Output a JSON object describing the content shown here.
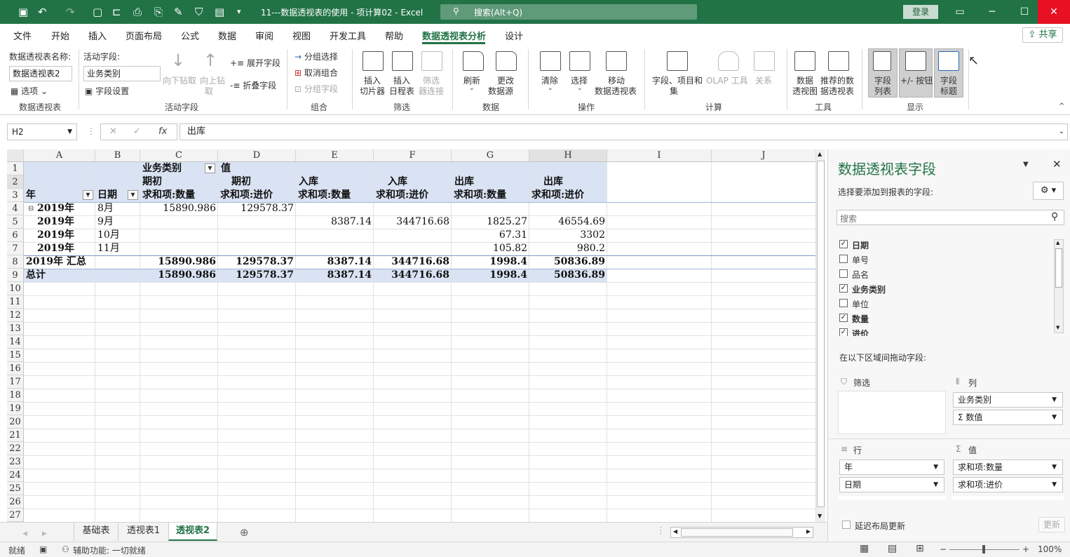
{
  "app": {
    "title": "11---数据透视表的使用 - 项计算02 - Excel",
    "search_placeholder": "搜索(Alt+Q)",
    "login": "登录",
    "share": "共享"
  },
  "menu": [
    "文件",
    "开始",
    "插入",
    "页面布局",
    "公式",
    "数据",
    "审阅",
    "视图",
    "开发工具",
    "帮助",
    "数据透视表分析",
    "设计"
  ],
  "active_menu": "数据透视表分析",
  "ribbon": {
    "pt_name_label": "数据透视表名称:",
    "pt_name_value": "数据透视表2",
    "options": "选项",
    "group_pivottable": "数据透视表",
    "active_field_label": "活动字段:",
    "active_field_value": "业务类别",
    "field_settings": "字段设置",
    "drill_down": "向下钻取",
    "drill_up_1": "向上钻",
    "drill_up_2": "取",
    "expand_field": "展开字段",
    "collapse_field": "折叠字段",
    "group_active_field": "活动字段",
    "group_selection": "分组选择",
    "ungroup": "取消组合",
    "group_field": "分组字段",
    "group_group": "组合",
    "insert_slicer_1": "插入",
    "insert_slicer_2": "切片器",
    "insert_timeline_1": "插入",
    "insert_timeline_2": "日程表",
    "filter_conn_1": "筛选",
    "filter_conn_2": "器连接",
    "group_filter": "筛选",
    "refresh": "刷新",
    "change_source_1": "更改",
    "change_source_2": "数据源",
    "group_data": "数据",
    "clear": "清除",
    "select": "选择",
    "move_pt_1": "移动",
    "move_pt_2": "数据透视表",
    "group_actions": "操作",
    "fields_items_1": "字段、项目和",
    "fields_items_2": "集",
    "olap_tools": "OLAP 工具",
    "relationships": "关系",
    "group_calc": "计算",
    "pivotchart_1": "数据",
    "pivotchart_2": "透视图",
    "recommended_1": "推荐的数",
    "recommended_2": "据透视表",
    "group_tools": "工具",
    "field_list_1": "字段",
    "field_list_2": "列表",
    "buttons": "+/- 按钮",
    "field_headers_1": "字段",
    "field_headers_2": "标题",
    "group_show": "显示"
  },
  "formula_bar": {
    "name_box": "H2",
    "content": "出库"
  },
  "columns": [
    "A",
    "B",
    "C",
    "D",
    "E",
    "F",
    "G",
    "H",
    "I",
    "J"
  ],
  "rows": [
    "1",
    "2",
    "3",
    "4",
    "5",
    "6",
    "7",
    "8",
    "9",
    "10",
    "11",
    "12",
    "13",
    "14",
    "15",
    "16",
    "17",
    "18",
    "19",
    "20",
    "21",
    "22",
    "23",
    "24",
    "25",
    "26",
    "27"
  ],
  "pivot": {
    "col_field": "业务类别",
    "values_label": "值",
    "cat_qichu": "期初",
    "cat_ruku": "入库",
    "cat_chuku": "出库",
    "h_year": "年",
    "h_date": "日期",
    "h_sum_qty": "求和项:数量",
    "h_sum_price": "求和项:进价",
    "year": "2019年",
    "m8": "8月",
    "m9": "9月",
    "m10": "10月",
    "m11": "11月",
    "r4c": "15890.986",
    "r4d": "129578.37",
    "r5e": "8387.14",
    "r5f": "344716.68",
    "r5g": "1825.27",
    "r5h": "46554.69",
    "r6g": "67.31",
    "r6h": "3302",
    "r7g": "105.82",
    "r7h": "980.2",
    "subtotal_label": "2019年 汇总",
    "st_c": "15890.986",
    "st_d": "129578.37",
    "st_e": "8387.14",
    "st_f": "344716.68",
    "st_g": "1998.4",
    "st_h": "50836.89",
    "total_label": "总计",
    "gt_c": "15890.986",
    "gt_d": "129578.37",
    "gt_e": "8387.14",
    "gt_f": "344716.68",
    "gt_g": "1998.4",
    "gt_h": "50836.89"
  },
  "sheets": [
    "基础表",
    "透视表1",
    "透视表2"
  ],
  "active_sheet": "透视表2",
  "status": {
    "ready": "就绪",
    "accessibility": "辅助功能: 一切就绪",
    "zoom": "100%"
  },
  "pane": {
    "title": "数据透视表字段",
    "subtitle": "选择要添加到报表的字段:",
    "search_placeholder": "搜索",
    "fields": [
      {
        "name": "日期",
        "checked": true
      },
      {
        "name": "单号",
        "checked": false
      },
      {
        "name": "品名",
        "checked": false
      },
      {
        "name": "业务类别",
        "checked": true
      },
      {
        "name": "单位",
        "checked": false
      },
      {
        "name": "数量",
        "checked": true
      },
      {
        "name": "进价",
        "checked": true
      }
    ],
    "drag_hint": "在以下区域间拖动字段:",
    "filter_label": "筛选",
    "columns_label": "列",
    "rows_label": "行",
    "values_label": "值",
    "col_item1": "业务类别",
    "col_item2": "Σ 数值",
    "row_item1": "年",
    "row_item2": "日期",
    "val_item1": "求和项:数量",
    "val_item2": "求和项:进价",
    "defer_update": "延迟布局更新",
    "update": "更新"
  }
}
